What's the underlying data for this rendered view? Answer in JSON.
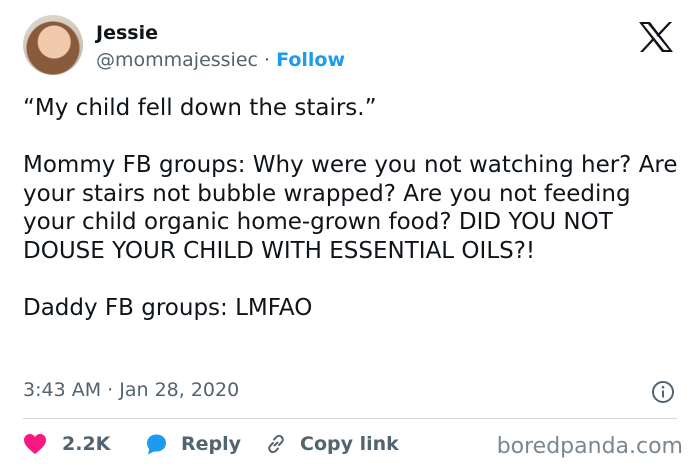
{
  "author": {
    "name": "Jessie",
    "handle": "@mommajessiec",
    "separator": " · ",
    "follow_label": "Follow"
  },
  "tweet": {
    "text": "“My child fell down the stairs.”\n\nMommy FB groups: Why were you not watching her? Are your stairs not bubble wrapped? Are you not feeding your child organic home-grown food? DID YOU NOT DOUSE YOUR CHILD WITH ESSENTIAL OILS?!\n\nDaddy FB groups: LMFAO",
    "time": "3:43 AM",
    "date_separator": " · ",
    "date": "Jan 28, 2020"
  },
  "actions": {
    "like_count": "2.2K",
    "reply_label": "Reply",
    "copy_link_label": "Copy link"
  },
  "icons": {
    "platform": "x-logo-icon",
    "info": "info-icon",
    "like": "heart-icon",
    "reply": "speech-bubble-icon",
    "copy": "link-icon"
  },
  "colors": {
    "like": "#f91880",
    "reply": "#1d9bf0",
    "follow": "#1d9bf0",
    "muted": "#536471"
  },
  "watermark": "boredpanda.com"
}
